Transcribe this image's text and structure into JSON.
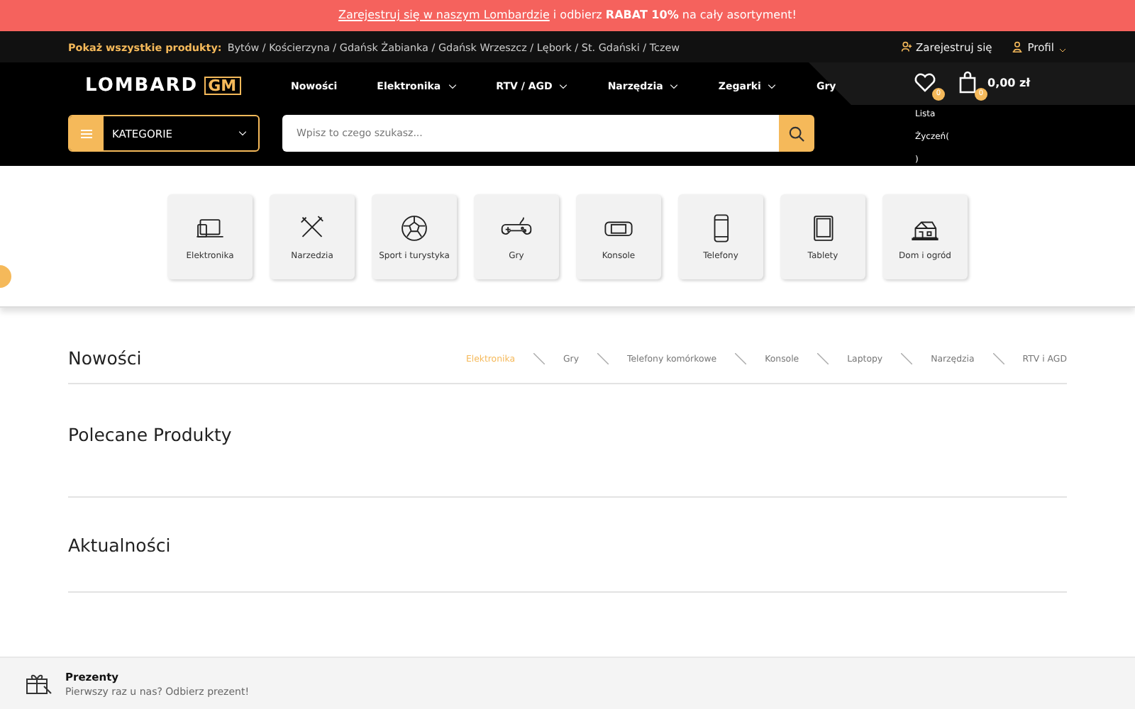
{
  "promo_banner": {
    "link": "Zarejestruj się w naszym Lombardzie",
    "text": "i odbierz **RABAT 10%** na cały asortyment!"
  },
  "top_bar": {
    "label": "Pokaż wszystkie produkty:",
    "locations": "Bytów / Kościerzyna / Gdańsk Żabianka / Gdańsk Wrzeszcz / Lębork / St. Gdański / Tczew",
    "register": "Zarejestruj się",
    "profile": "Profil"
  },
  "header": {
    "logo": {
      "text": "LOMBARD",
      "mark": "GM"
    },
    "nav": [
      {
        "label": "Nowości",
        "dropdown": false
      },
      {
        "label": "Elektronika",
        "dropdown": true
      },
      {
        "label": "RTV / AGD",
        "dropdown": true
      },
      {
        "label": "Narzędzia",
        "dropdown": true
      },
      {
        "label": "Zegarki",
        "dropdown": true
      },
      {
        "label": "Gry",
        "dropdown": false
      }
    ],
    "wishlist": {
      "badge": "0",
      "label_lines": [
        "Lista",
        "Życzeń(",
        ")"
      ]
    },
    "cart": {
      "badge": "0",
      "total": "0,00 zł"
    },
    "categories_button": "KATEGORIE",
    "search": {
      "placeholder": "Wpisz to czego szukasz..."
    }
  },
  "category_tiles": [
    {
      "label": "Elektronika"
    },
    {
      "label": "Narzedzia"
    },
    {
      "label": "Sport i turystyka"
    },
    {
      "label": "Gry"
    },
    {
      "label": "Konsole"
    },
    {
      "label": "Telefony"
    },
    {
      "label": "Tablety"
    },
    {
      "label": "Dom i ogród"
    }
  ],
  "sections": [
    {
      "title": "Nowości",
      "tabs": [
        {
          "label": "Elektronika",
          "selected": true
        },
        {
          "label": "Gry",
          "selected": false
        },
        {
          "label": "Telefony komórkowe",
          "selected": false
        },
        {
          "label": "Konsole",
          "selected": false
        },
        {
          "label": "Laptopy",
          "selected": false
        },
        {
          "label": "Narzędzia",
          "selected": false
        },
        {
          "label": "RTV i AGD",
          "selected": false
        }
      ]
    },
    {
      "title": "Polecane Produkty"
    },
    {
      "title": "Aktualności"
    }
  ],
  "gift_bar": {
    "title": "Prezenty",
    "text": "Pierwszy raz u nas? Odbierz prezent!"
  }
}
